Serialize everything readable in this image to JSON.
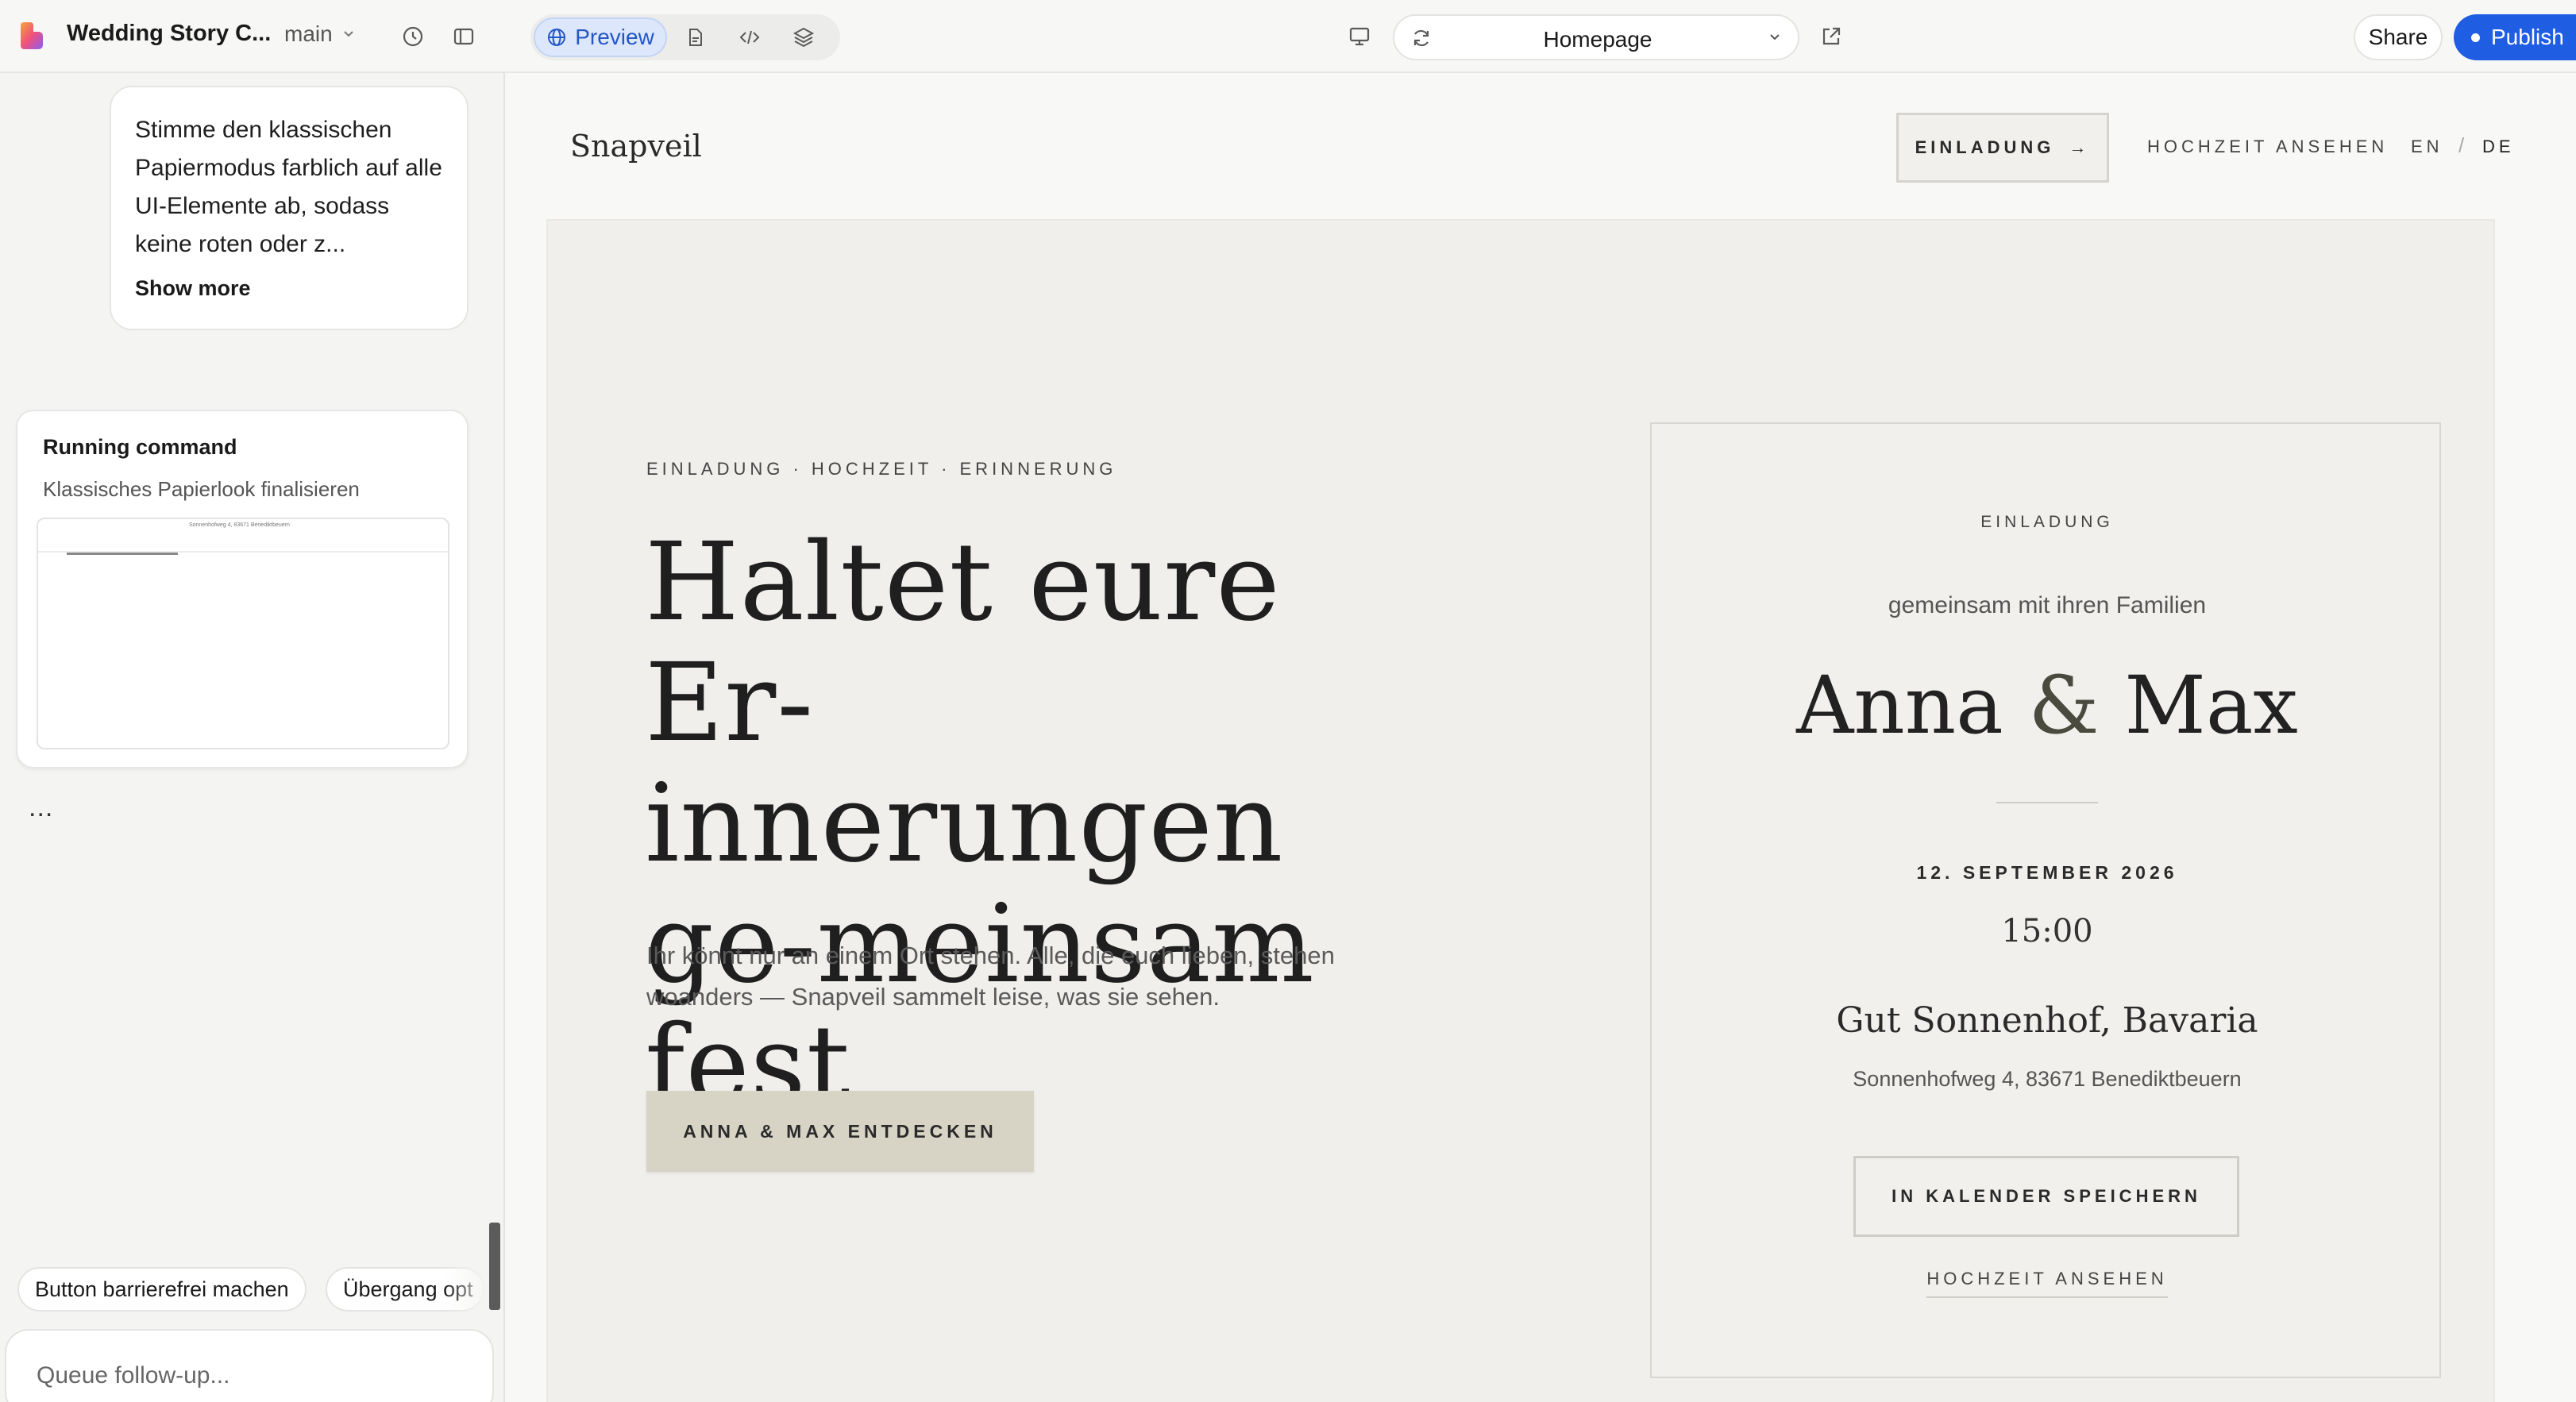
{
  "topbar": {
    "project_title": "Wedding Story C...",
    "branch": "main",
    "preview_label": "Preview",
    "page_selector": "Homepage",
    "share_label": "Share",
    "publish_label": "Publish",
    "colors": {
      "accent": "#1f5de3",
      "preview_bg": "#dde7fb"
    }
  },
  "chat": {
    "message": "Stimme den klassischen Papiermodus farblich auf alle UI-Elemente ab, sodass keine roten oder z...",
    "show_more": "Show more",
    "running": {
      "title": "Running command",
      "subtitle": "Klassisches Papierlook finalisieren",
      "thumb_text": "Sonnenhofweg 4, 83671 Benediktbeuern"
    },
    "ellipsis": "...",
    "suggestions": [
      "Button barrierefrei machen",
      "Übergang opt"
    ],
    "queue_placeholder": "Queue follow-up..."
  },
  "site": {
    "brand": "Snapveil",
    "nav": {
      "cta": "EINLADUNG",
      "cta_arrow": "→",
      "watch": "HOCHZEIT ANSEHEN",
      "lang_en": "EN",
      "lang_sep": "/",
      "lang_de": "DE"
    },
    "hero": {
      "eyebrow": "EINLADUNG · HOCHZEIT · ERINNERUNG",
      "headline": "Haltet eure Er-innerungen ge-meinsam fest",
      "body": "Ihr könnt nur an einem Ort stehen. Alle, die euch lieben, stehen woanders — Snapveil sammelt leise, was sie sehen.",
      "button": "ANNA & MAX ENTDECKEN"
    },
    "card": {
      "eyebrow": "EINLADUNG",
      "together": "gemeinsam mit ihren Familien",
      "name1": "Anna",
      "amp": "&",
      "name2": "Max",
      "date": "12. SEPTEMBER 2026",
      "time": "15:00",
      "venue": "Gut Sonnenhof, Bavaria",
      "address": "Sonnenhofweg 4, 83671 Benediktbeuern",
      "calendar_button": "IN KALENDER SPEICHERN",
      "watch_link": "HOCHZEIT ANSEHEN"
    }
  }
}
